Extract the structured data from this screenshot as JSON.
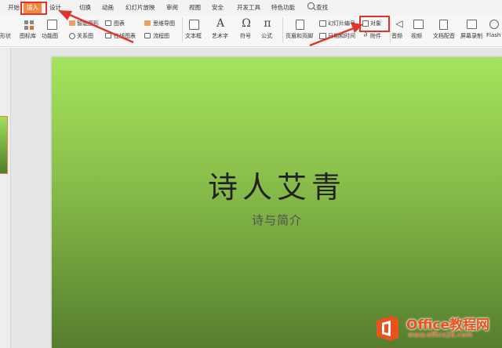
{
  "menu": {
    "tabs": [
      "开始",
      "插入",
      "设计",
      "切换",
      "动画",
      "幻灯片放映",
      "审阅",
      "视图",
      "安全",
      "开发工具",
      "特色功能"
    ],
    "active_tab": "插入",
    "search_label": "查找"
  },
  "ribbon": {
    "shape_label": "形状",
    "icon_lib_label": "图标库",
    "func_chart_label": "功能图",
    "smart_shape_label": "智能图形",
    "relation_label": "关系图",
    "chart_label": "图表",
    "online_chart_label": "在线图表",
    "mind_map_label": "思维导图",
    "flowchart_label": "流程图",
    "textbox_label": "文本框",
    "art_text_label": "艺术字",
    "symbol_label": "符号",
    "formula_label": "公式",
    "header_footer_label": "页眉和页脚",
    "slide_number_label": "幻灯片编号",
    "datetime_label": "日期和时间",
    "object_label": "对象",
    "attachment_label": "附件",
    "audio_label": "音频",
    "video_label": "视频",
    "doc_audio_label": "文档配音",
    "screen_record_label": "屏幕录制",
    "flash_label": "Flash"
  },
  "slide": {
    "title": "诗人艾青",
    "subtitle": "诗与简介"
  },
  "watermark": {
    "brand": "Office教程网",
    "url": "www.office26.com"
  },
  "colors": {
    "active_tab": "#f08a3e",
    "annotation": "#e0352b",
    "slide_top": "#a4e45c",
    "slide_bottom": "#557d2e"
  }
}
